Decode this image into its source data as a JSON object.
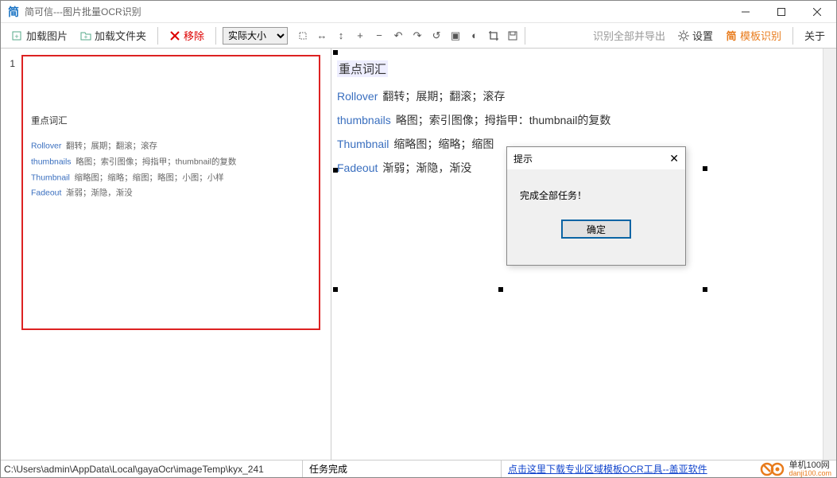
{
  "window": {
    "title": "简可信---图片批量OCR识别"
  },
  "toolbar": {
    "load_image": "加载图片",
    "load_folder": "加载文件夹",
    "remove": "移除",
    "zoom_select": "实际大小",
    "recognize_export": "识别全部并导出",
    "settings": "设置",
    "template": "模板识别",
    "about": "关于"
  },
  "left": {
    "index": "1",
    "thumb": {
      "heading": "重点词汇",
      "rows": [
        {
          "k": "Rollover",
          "v": "翻转；展期；翻滚；滚存"
        },
        {
          "k": "thumbnails",
          "v": "略图；索引图像；拇指甲；thumbnail的复数"
        },
        {
          "k": "Thumbnail",
          "v": "缩略图；缩略；缩图；略图；小图；小样"
        },
        {
          "k": "Fadeout",
          "v": "渐弱；渐隐，渐没"
        }
      ]
    }
  },
  "ocr": {
    "heading": "重点词汇",
    "lines": [
      {
        "k": "Rollover",
        "v": "翻转；展期；翻滚；滚存"
      },
      {
        "k": "thumbnails",
        "v": "略图；索引图像；拇指甲：thumbnail的复数"
      },
      {
        "k": "Thumbnail",
        "v": "缩略图；缩略；缩图"
      },
      {
        "k": "Fadeout",
        "v": "渐弱；渐隐，渐没"
      }
    ]
  },
  "dialog": {
    "title": "提示",
    "message": "完成全部任务！",
    "ok": "确定"
  },
  "status": {
    "path": "C:\\Users\\admin\\AppData\\Local\\gayaOcr\\imageTemp\\kyx_241",
    "state": "任务完成",
    "link": "点击这里下载专业区域模板OCR工具--盖亚软件",
    "logo1": "单机100网",
    "logo2": "danji100.com"
  }
}
